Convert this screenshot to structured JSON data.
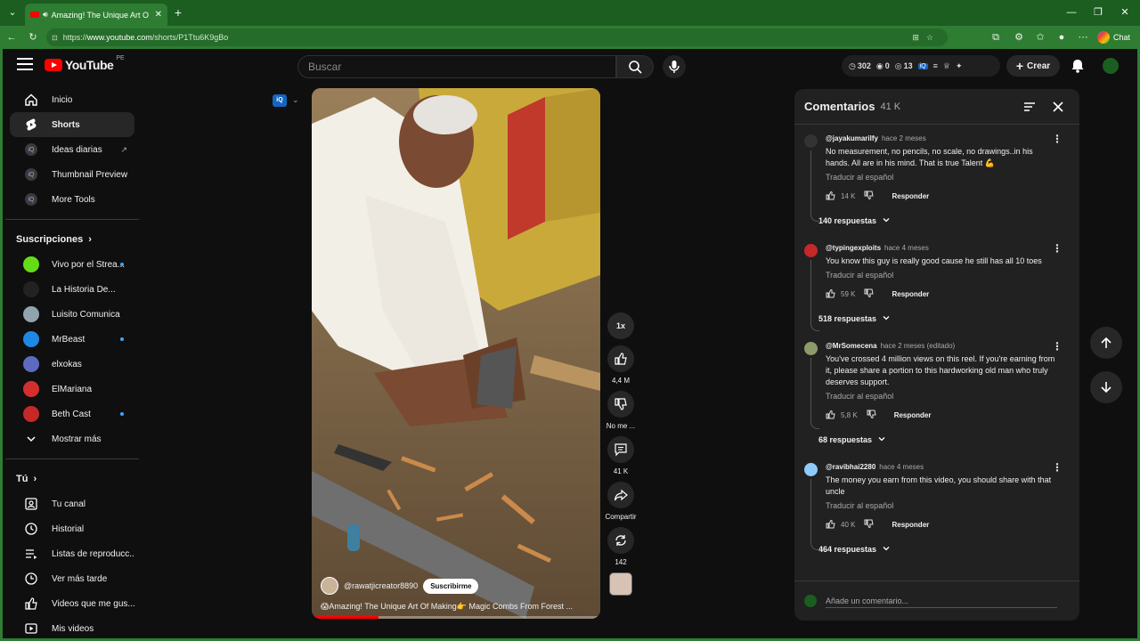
{
  "browser": {
    "tab_title": "Amazing! The Unique Art O",
    "url_prefix": "https://",
    "url_domain": "www.youtube.com",
    "url_path": "/shorts/P1Ttu6K9gBo",
    "copilot_label": "Chat"
  },
  "masthead": {
    "logo_text": "YouTube",
    "country_code": "PE",
    "search_placeholder": "Buscar",
    "ext_views": "302",
    "ext_count_a": "0",
    "ext_count_b": "13",
    "create_label": "Crear"
  },
  "sidebar": {
    "main": [
      {
        "label": "Inicio",
        "icon": "home-icon"
      },
      {
        "label": "Shorts",
        "icon": "shorts-icon"
      },
      {
        "label": "Ideas diarias",
        "icon": "ideas-icon"
      },
      {
        "label": "Thumbnail Preview",
        "icon": "thumbnail-icon"
      },
      {
        "label": "More Tools",
        "icon": "tools-icon"
      }
    ],
    "subs_heading": "Suscripciones",
    "subscriptions": [
      {
        "label": "Vivo por el Strea...",
        "color": "#64dd17",
        "new": true
      },
      {
        "label": "La Historia De...",
        "color": "#222222",
        "new": false
      },
      {
        "label": "Luisito Comunica",
        "color": "#90a4ae",
        "new": false
      },
      {
        "label": "MrBeast",
        "color": "#1e88e5",
        "new": true
      },
      {
        "label": "elxokas",
        "color": "#5c6bc0",
        "new": false
      },
      {
        "label": "ElMariana",
        "color": "#d32f2f",
        "new": false
      },
      {
        "label": "Beth Cast",
        "color": "#c62828",
        "new": true
      }
    ],
    "show_more": "Mostrar más",
    "you_heading": "Tú",
    "you_items": [
      {
        "label": "Tu canal",
        "icon": "channel-icon"
      },
      {
        "label": "Historial",
        "icon": "history-icon"
      },
      {
        "label": "Listas de reproducc...",
        "icon": "playlists-icon"
      },
      {
        "label": "Ver más tarde",
        "icon": "watch-later-icon"
      },
      {
        "label": "Videos que me gus...",
        "icon": "liked-icon"
      },
      {
        "label": "Mis videos",
        "icon": "my-videos-icon"
      }
    ]
  },
  "short": {
    "badge": "iQ",
    "channel": "@rawatjicreator8890",
    "subscribe": "Suscribirme",
    "title": "😱Amazing! The Unique Art Of Making👉 Magic Combs From Forest ...",
    "progress": 0.23,
    "speed": "1x",
    "likes": "4,4 M",
    "dislike_label": "No me ...",
    "comments": "41 K",
    "share_label": "Compartir",
    "remix": "142"
  },
  "comments_panel": {
    "title": "Comentarios",
    "count": "41 K",
    "translate": "Traducir al español",
    "reply": "Responder",
    "input_placeholder": "Añade un comentario...",
    "items": [
      {
        "author": "@jayakumarilfy",
        "time": "hace 2 meses",
        "text": "No measurement, no pencils, no scale, no drawings..in his hands. All are in his mind. That is true Talent 💪",
        "likes": "14 K",
        "replies": "140 respuestas",
        "color": "#333333"
      },
      {
        "author": "@typingexploits",
        "time": "hace 4 meses",
        "text": "You know this guy is really good cause he still has all 10 toes",
        "likes": "59 K",
        "replies": "518 respuestas",
        "color": "#c62828"
      },
      {
        "author": "@MrSomecena",
        "time": "hace 2 meses (editado)",
        "text": "You've crossed 4 million views on this reel. If you're earning from it, please share a portion to this hardworking old man who truly deserves support.",
        "likes": "5,8 K",
        "replies": "68 respuestas",
        "color": "#8d9b6a"
      },
      {
        "author": "@ravibhai2280",
        "time": "hace 4 meses",
        "text": "The money you earn from this video, you should share with that uncle",
        "likes": "40 K",
        "replies": "464 respuestas",
        "color": "#90caf9"
      }
    ]
  }
}
